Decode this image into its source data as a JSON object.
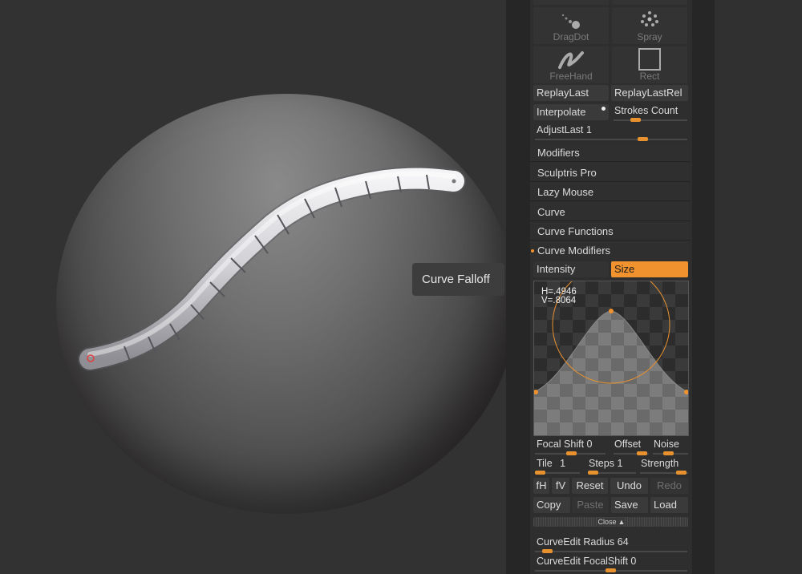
{
  "tooltip": {
    "text": "Curve Falloff"
  },
  "tools": {
    "tiles": [
      {
        "label": "DragDot"
      },
      {
        "label": "Spray"
      },
      {
        "label": "FreeHand"
      },
      {
        "label": "Rect"
      }
    ]
  },
  "buttons": {
    "replay_last": "ReplayLast",
    "replay_last_rel": "ReplayLastRel",
    "interpolate": "Interpolate",
    "strokes_count": "Strokes Count",
    "adjust_last": "AdjustLast",
    "adjust_last_value": "1"
  },
  "menu": {
    "modifiers": "Modifiers",
    "sculptris_pro": "Sculptris Pro",
    "lazy_mouse": "Lazy Mouse",
    "curve": "Curve",
    "curve_functions": "Curve Functions",
    "curve_modifiers": "Curve Modifiers"
  },
  "curve_tabs": {
    "intensity": "Intensity",
    "size": "Size"
  },
  "curve_editor": {
    "h_readout": "H=.4946",
    "v_readout": "V=.8064"
  },
  "sliders": {
    "focal_shift": "Focal Shift",
    "focal_shift_value": "0",
    "offset": "Offset",
    "noise": "Noise",
    "tile": "Tile",
    "tile_value": "1",
    "steps": "Steps",
    "steps_value": "1",
    "strength": "Strength"
  },
  "actions": {
    "fh": "fH",
    "fv": "fV",
    "reset": "Reset",
    "undo": "Undo",
    "redo": "Redo",
    "copy": "Copy",
    "paste": "Paste",
    "save": "Save",
    "load": "Load",
    "close": "Close"
  },
  "curve_edit": {
    "radius_label": "CurveEdit Radius",
    "radius_value": "64",
    "focal_label": "CurveEdit FocalShift",
    "focal_value": "0"
  },
  "colors": {
    "accent": "#f0922e",
    "panel": "#2e2e2e",
    "button": "#3a3a3a"
  }
}
